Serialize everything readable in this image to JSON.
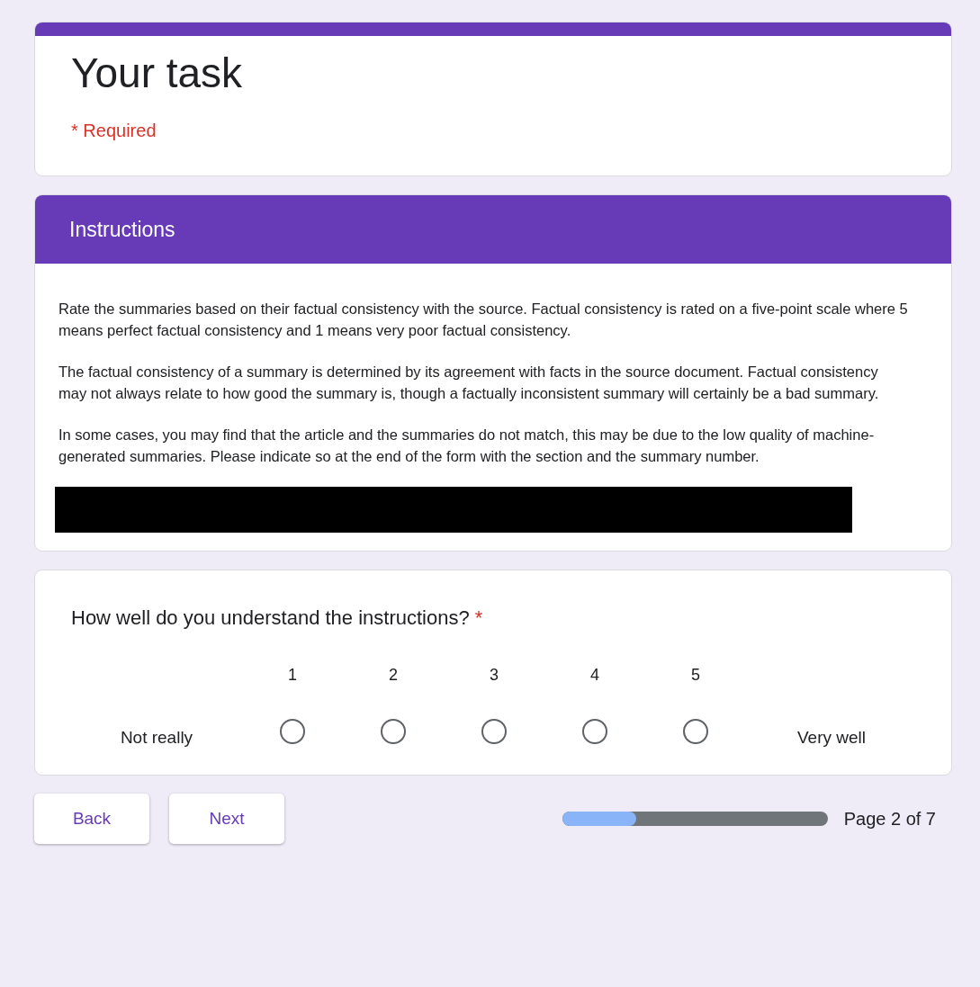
{
  "form": {
    "title": "Your task",
    "required_note": "* Required"
  },
  "section": {
    "title": "Instructions",
    "paragraphs": [
      "Rate the summaries based on their factual consistency with the source. Factual consistency is rated on a five-point scale where 5 means perfect factual consistency and 1 means very poor factual consistency.",
      "The factual consistency of a summary is determined by its agreement with facts in the source document. Factual consistency may not always relate to how good the summary is, though a factually inconsistent summary will certainly be a bad summary.",
      "In some cases, you may find that the article and the summaries do not match, this may be due to the low quality of machine-generated summaries. Please indicate so at the end of the form with the section and the summary number."
    ]
  },
  "question": {
    "text": "How well do you understand the instructions?",
    "required_mark": "*",
    "low_label": "Not really",
    "high_label": "Very well",
    "options": [
      {
        "label": "1",
        "selected": false
      },
      {
        "label": "2",
        "selected": false
      },
      {
        "label": "3",
        "selected": false
      },
      {
        "label": "4",
        "selected": false
      },
      {
        "label": "5",
        "selected": false
      }
    ]
  },
  "buttons": [
    "Back",
    "Next"
  ],
  "progress": {
    "level": 0.28,
    "label": "Page 2 of 7"
  }
}
